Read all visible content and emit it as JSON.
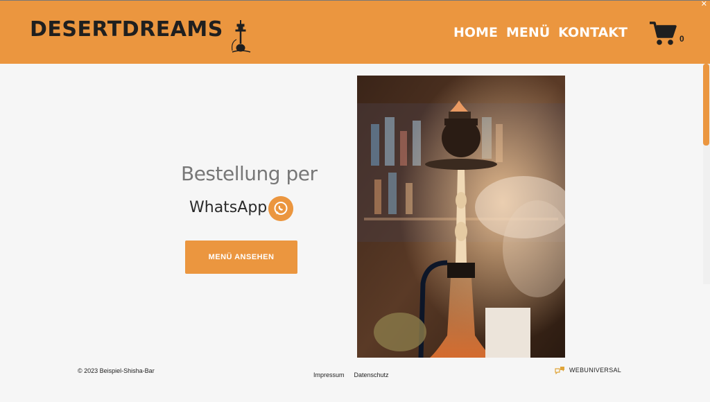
{
  "header": {
    "logo_text": "DESERTDREAMS",
    "logo_icon": "hookah-icon",
    "nav": [
      {
        "label": "HOME"
      },
      {
        "label": "MENÜ"
      },
      {
        "label": "KONTAKT"
      }
    ],
    "cart_icon": "cart-icon",
    "cart_count": "0"
  },
  "hero": {
    "line1": "Bestellung per",
    "line2": "WhatsApp",
    "whatsapp_icon": "whatsapp-icon",
    "button_label": "MENÜ ANSEHEN",
    "image_subject": "hookah-photo"
  },
  "footer": {
    "copyright": "© 2023 Beispiel-Shisha-Bar",
    "links": [
      {
        "label": "Impressum"
      },
      {
        "label": "Datenschutz"
      }
    ],
    "brand": "WEBUNIVERSAL"
  },
  "colors": {
    "accent": "#eb963f",
    "background": "#f6f6f6",
    "text_dark": "#1f1f1f"
  }
}
